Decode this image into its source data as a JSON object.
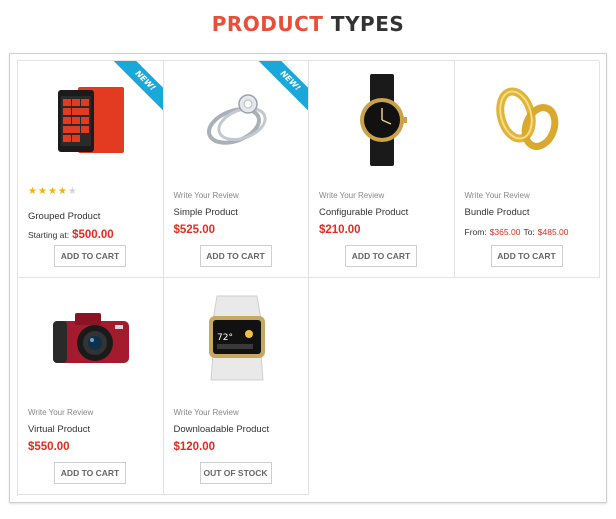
{
  "heading": {
    "accent": "PRODUCT",
    "rest": "TYPES"
  },
  "colors": {
    "accent": "#e94e3b",
    "price": "#e32b1f",
    "ribbon": "#1aa7d9",
    "star": "#f5b400"
  },
  "products": [
    {
      "name": "Grouped Product",
      "badge": "NEW!",
      "image_icon": "smartphone-icon",
      "rating": 4,
      "rating_max": 5,
      "price_prefix": "Starting at:",
      "price": "$500.00",
      "button": "ADD TO CART"
    },
    {
      "name": "Simple Product",
      "badge": "NEW!",
      "image_icon": "ring-icon",
      "review_link": "Write Your Review",
      "price": "$525.00",
      "button": "ADD TO CART"
    },
    {
      "name": "Configurable Product",
      "image_icon": "watch-icon",
      "review_link": "Write Your Review",
      "price": "$210.00",
      "button": "ADD TO CART"
    },
    {
      "name": "Bundle Product",
      "image_icon": "wedding-rings-icon",
      "review_link": "Write Your Review",
      "price_from_label": "From:",
      "price_from": "$365.00",
      "price_to_label": "To:",
      "price_to": "$485.00",
      "button": "ADD TO CART"
    },
    {
      "name": "Virtual Product",
      "image_icon": "camera-icon",
      "review_link": "Write Your Review",
      "price": "$550.00",
      "button": "ADD TO CART"
    },
    {
      "name": "Downloadable Product",
      "image_icon": "smartwatch-icon",
      "review_link": "Write Your Review",
      "price": "$120.00",
      "button": "OUT OF STOCK"
    }
  ]
}
